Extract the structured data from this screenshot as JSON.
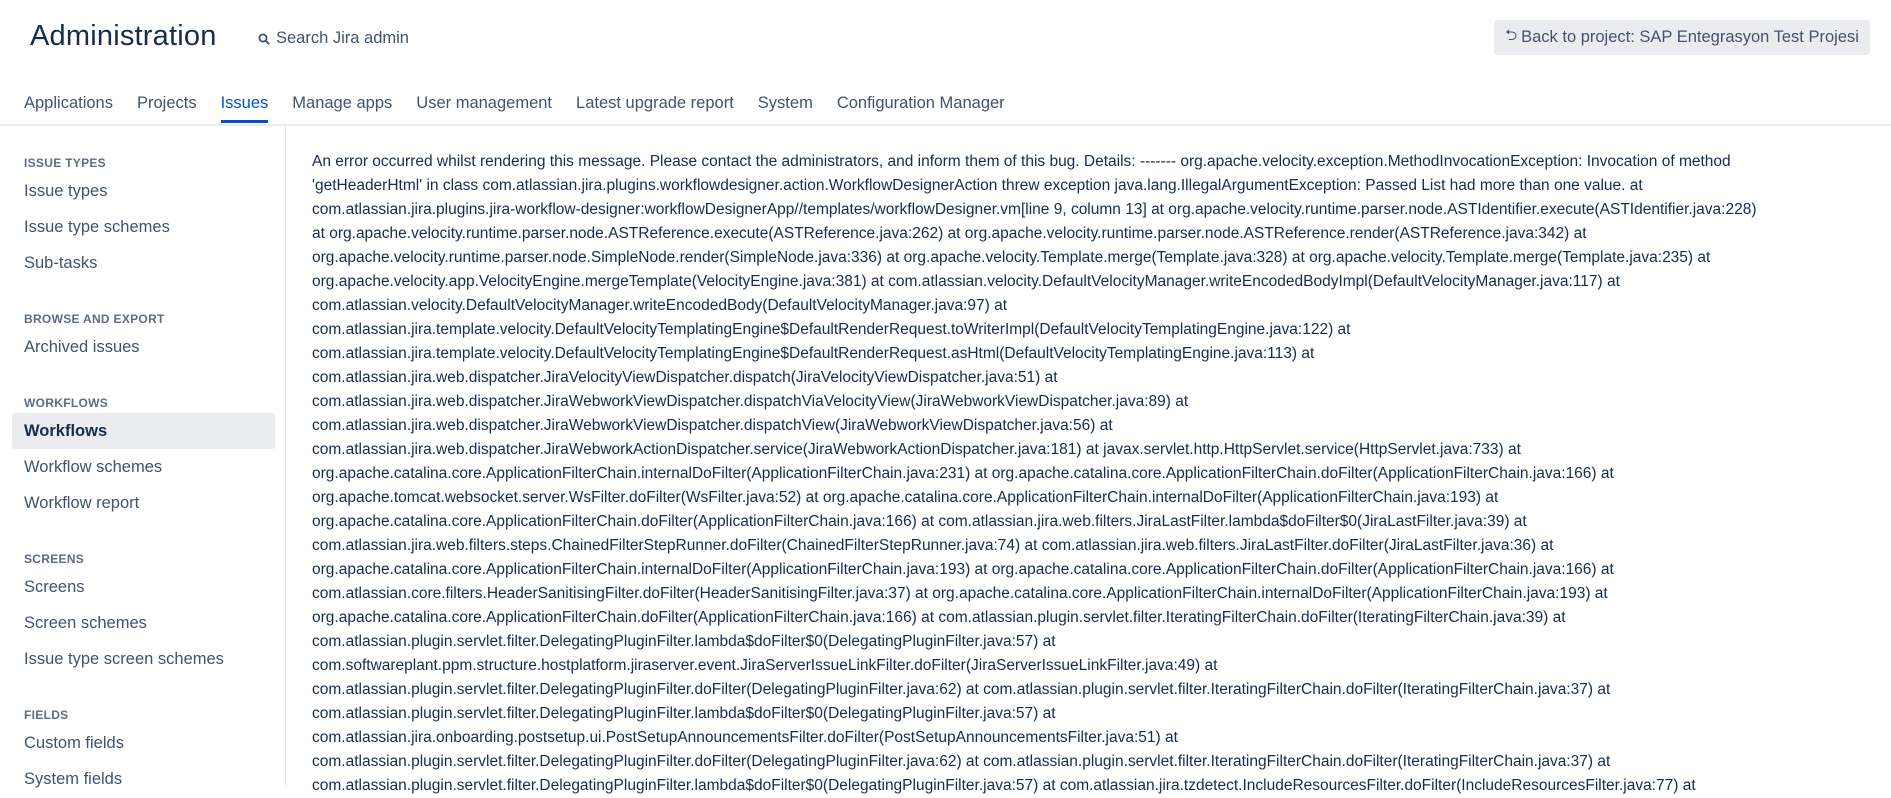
{
  "header": {
    "title": "Administration",
    "search_label": "Search Jira admin",
    "back_button_label": "Back to project: SAP Entegrasyon Test Projesi"
  },
  "tabs": [
    {
      "label": "Applications"
    },
    {
      "label": "Projects"
    },
    {
      "label": "Issues"
    },
    {
      "label": "Manage apps"
    },
    {
      "label": "User management"
    },
    {
      "label": "Latest upgrade report"
    },
    {
      "label": "System"
    },
    {
      "label": "Configuration Manager"
    }
  ],
  "sidebar": {
    "issue_types": {
      "heading": "ISSUE TYPES",
      "items": [
        {
          "label": "Issue types"
        },
        {
          "label": "Issue type schemes"
        },
        {
          "label": "Sub-tasks"
        }
      ]
    },
    "browse_export": {
      "heading": "BROWSE AND EXPORT",
      "items": [
        {
          "label": "Archived issues"
        }
      ]
    },
    "workflows": {
      "heading": "WORKFLOWS",
      "items": [
        {
          "label": "Workflows"
        },
        {
          "label": "Workflow schemes"
        },
        {
          "label": "Workflow report"
        }
      ]
    },
    "screens": {
      "heading": "SCREENS",
      "items": [
        {
          "label": "Screens"
        },
        {
          "label": "Screen schemes"
        },
        {
          "label": "Issue type screen schemes"
        }
      ]
    },
    "fields": {
      "heading": "FIELDS",
      "items": [
        {
          "label": "Custom fields"
        },
        {
          "label": "System fields"
        }
      ]
    }
  },
  "error_lines": [
    "An error occurred whilst rendering this message. Please contact the administrators, and inform them of this bug. Details: ------- org.apache.velocity.exception.MethodInvocationException: Invocation of method",
    "'getHeaderHtml' in class com.atlassian.jira.plugins.workflowdesigner.action.WorkflowDesignerAction threw exception java.lang.IllegalArgumentException: Passed List had more than one value. at",
    "com.atlassian.jira.plugins.jira-workflow-designer:workflowDesignerApp//templates/workflowDesigner.vm[line 9, column 13] at org.apache.velocity.runtime.parser.node.ASTIdentifier.execute(ASTIdentifier.java:228)",
    "at org.apache.velocity.runtime.parser.node.ASTReference.execute(ASTReference.java:262) at org.apache.velocity.runtime.parser.node.ASTReference.render(ASTReference.java:342) at",
    "org.apache.velocity.runtime.parser.node.SimpleNode.render(SimpleNode.java:336) at org.apache.velocity.Template.merge(Template.java:328) at org.apache.velocity.Template.merge(Template.java:235) at",
    "org.apache.velocity.app.VelocityEngine.mergeTemplate(VelocityEngine.java:381) at com.atlassian.velocity.DefaultVelocityManager.writeEncodedBodyImpl(DefaultVelocityManager.java:117) at",
    "com.atlassian.velocity.DefaultVelocityManager.writeEncodedBody(DefaultVelocityManager.java:97) at",
    "com.atlassian.jira.template.velocity.DefaultVelocityTemplatingEngine$DefaultRenderRequest.toWriterImpl(DefaultVelocityTemplatingEngine.java:122) at",
    "com.atlassian.jira.template.velocity.DefaultVelocityTemplatingEngine$DefaultRenderRequest.asHtml(DefaultVelocityTemplatingEngine.java:113) at",
    "com.atlassian.jira.web.dispatcher.JiraVelocityViewDispatcher.dispatch(JiraVelocityViewDispatcher.java:51) at",
    "com.atlassian.jira.web.dispatcher.JiraWebworkViewDispatcher.dispatchViaVelocityView(JiraWebworkViewDispatcher.java:89) at",
    "com.atlassian.jira.web.dispatcher.JiraWebworkViewDispatcher.dispatchView(JiraWebworkViewDispatcher.java:56) at",
    "com.atlassian.jira.web.dispatcher.JiraWebworkActionDispatcher.service(JiraWebworkActionDispatcher.java:181) at javax.servlet.http.HttpServlet.service(HttpServlet.java:733) at",
    "org.apache.catalina.core.ApplicationFilterChain.internalDoFilter(ApplicationFilterChain.java:231) at org.apache.catalina.core.ApplicationFilterChain.doFilter(ApplicationFilterChain.java:166) at",
    "org.apache.tomcat.websocket.server.WsFilter.doFilter(WsFilter.java:52) at org.apache.catalina.core.ApplicationFilterChain.internalDoFilter(ApplicationFilterChain.java:193) at",
    "org.apache.catalina.core.ApplicationFilterChain.doFilter(ApplicationFilterChain.java:166) at com.atlassian.jira.web.filters.JiraLastFilter.lambda$doFilter$0(JiraLastFilter.java:39) at",
    "com.atlassian.jira.web.filters.steps.ChainedFilterStepRunner.doFilter(ChainedFilterStepRunner.java:74) at com.atlassian.jira.web.filters.JiraLastFilter.doFilter(JiraLastFilter.java:36) at",
    "org.apache.catalina.core.ApplicationFilterChain.internalDoFilter(ApplicationFilterChain.java:193) at org.apache.catalina.core.ApplicationFilterChain.doFilter(ApplicationFilterChain.java:166) at",
    "com.atlassian.core.filters.HeaderSanitisingFilter.doFilter(HeaderSanitisingFilter.java:37) at org.apache.catalina.core.ApplicationFilterChain.internalDoFilter(ApplicationFilterChain.java:193) at",
    "org.apache.catalina.core.ApplicationFilterChain.doFilter(ApplicationFilterChain.java:166) at com.atlassian.plugin.servlet.filter.IteratingFilterChain.doFilter(IteratingFilterChain.java:39) at",
    "com.atlassian.plugin.servlet.filter.DelegatingPluginFilter.lambda$doFilter$0(DelegatingPluginFilter.java:57) at",
    "com.softwareplant.ppm.structure.hostplatform.jiraserver.event.JiraServerIssueLinkFilter.doFilter(JiraServerIssueLinkFilter.java:49) at",
    "com.atlassian.plugin.servlet.filter.DelegatingPluginFilter.doFilter(DelegatingPluginFilter.java:62) at com.atlassian.plugin.servlet.filter.IteratingFilterChain.doFilter(IteratingFilterChain.java:37) at",
    "com.atlassian.plugin.servlet.filter.DelegatingPluginFilter.lambda$doFilter$0(DelegatingPluginFilter.java:57) at",
    "com.atlassian.jira.onboarding.postsetup.ui.PostSetupAnnouncementsFilter.doFilter(PostSetupAnnouncementsFilter.java:51) at",
    "com.atlassian.plugin.servlet.filter.DelegatingPluginFilter.doFilter(DelegatingPluginFilter.java:62) at com.atlassian.plugin.servlet.filter.IteratingFilterChain.doFilter(IteratingFilterChain.java:37) at",
    "com.atlassian.plugin.servlet.filter.DelegatingPluginFilter.lambda$doFilter$0(DelegatingPluginFilter.java:57) at com.atlassian.jira.tzdetect.IncludeResourcesFilter.doFilter(IncludeResourcesFilter.java:77) at"
  ]
}
